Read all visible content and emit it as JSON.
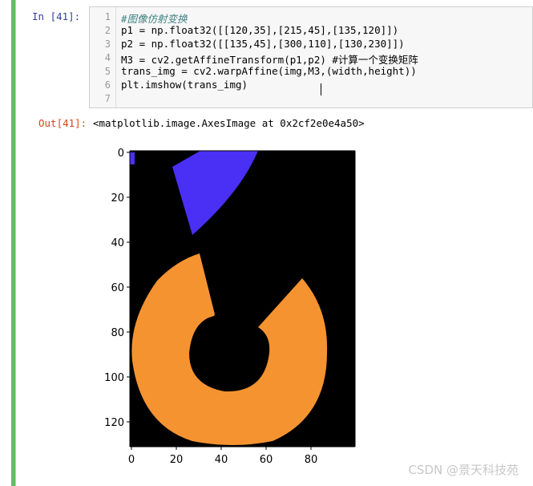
{
  "cell": {
    "in_prompt": "In  [41]:",
    "out_prompt": "Out[41]:",
    "line_numbers": [
      "1",
      "2",
      "3",
      "4",
      "5",
      "6",
      "7"
    ],
    "code_lines": [
      "#图像仿射变换",
      "p1 = np.float32([[120,35],[215,45],[135,120]])",
      "p2 = np.float32([[135,45],[300,110],[130,230]])",
      "M3 = cv2.getAffineTransform(p1,p2) #计算一个变换矩阵",
      "trans_img = cv2.warpAffine(img,M3,(width,height))",
      "plt.imshow(trans_img)",
      ""
    ],
    "output_text": "<matplotlib.image.AxesImage at 0x2cf2e0e4a50>"
  },
  "plot": {
    "x_ticks": [
      "0",
      "20",
      "40",
      "60",
      "80"
    ],
    "y_ticks": [
      "0",
      "20",
      "40",
      "60",
      "80",
      "100",
      "120"
    ]
  },
  "colors": {
    "image_background": "#000000",
    "blue_shape": "#4a2ff4",
    "orange_shape": "#f59331",
    "cell_bar": "#66bb6a"
  },
  "watermark": "CSDN @景天科技苑"
}
